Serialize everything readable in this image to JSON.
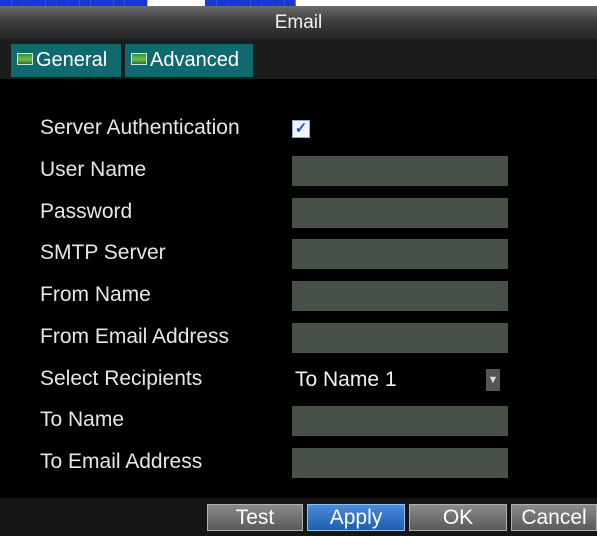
{
  "window": {
    "title": "Email"
  },
  "tabs": [
    {
      "label": "General",
      "active": true
    },
    {
      "label": "Advanced",
      "active": false
    }
  ],
  "form": {
    "server_authentication": {
      "label": "Server Authentication",
      "checked": true
    },
    "user_name": {
      "label": "User Name",
      "value": ""
    },
    "password": {
      "label": "Password",
      "value": ""
    },
    "smtp_server": {
      "label": "SMTP Server",
      "value": ""
    },
    "from_name": {
      "label": "From Name",
      "value": ""
    },
    "from_email_address": {
      "label": "From Email Address",
      "value": ""
    },
    "select_recipients": {
      "label": "Select Recipients",
      "value": "To Name 1"
    },
    "to_name": {
      "label": "To Name",
      "value": ""
    },
    "to_email_address": {
      "label": "To Email Address",
      "value": ""
    }
  },
  "buttons": {
    "test": "Test",
    "apply": "Apply",
    "ok": "OK",
    "cancel": "Cancel"
  },
  "colors": {
    "background": "#000000",
    "tab_active": "#0f6a70",
    "field": "#475147",
    "apply_button": "#2a6fc4",
    "top_link_text": "#1a35d6"
  }
}
